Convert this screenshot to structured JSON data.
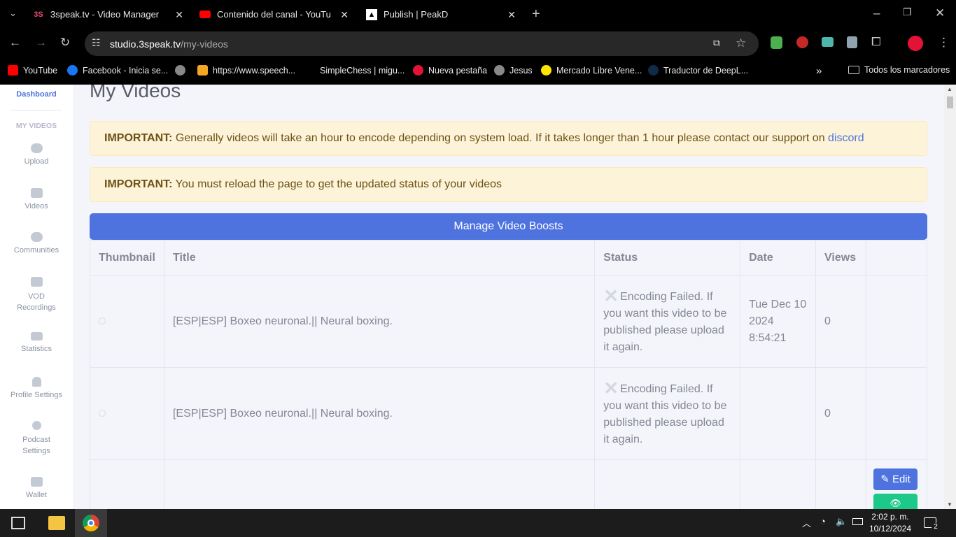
{
  "browser": {
    "tabs": [
      {
        "title": "3speak.tv - Video Manager",
        "favicon": "3speak-logo"
      },
      {
        "title": "Contenido del canal - YouTube",
        "favicon": "youtube-icon"
      },
      {
        "title": "Publish | PeakD",
        "favicon": "peakd-logo"
      }
    ],
    "url_host": "studio.3speak.tv",
    "url_path": "/my-videos",
    "bookmarks": [
      {
        "label": "YouTube",
        "color": "#ff0000"
      },
      {
        "label": "Facebook - Inicia se...",
        "color": "#1877f2"
      },
      {
        "label": "",
        "color": "#888888"
      },
      {
        "label": "https://www.speech...",
        "color": "#f5a623"
      },
      {
        "label": "SimpleChess | migu...",
        "color": "#000000"
      },
      {
        "label": "Nueva pestaña",
        "color": "#e31337"
      },
      {
        "label": "Jesus",
        "color": "#888888"
      },
      {
        "label": "Mercado Libre Vene...",
        "color": "#ffe600"
      },
      {
        "label": "Traductor de DeepL...",
        "color": "#0f2b46"
      }
    ],
    "all_bookmarks": "Todos los marcadores"
  },
  "sidebar": {
    "dashboard": "Dashboard",
    "section": "MY VIDEOS",
    "items": [
      {
        "label": "Upload",
        "icon": "cloud-upload-icon"
      },
      {
        "label": "Videos",
        "icon": "video-icon"
      },
      {
        "label": "Communities",
        "icon": "users-icon"
      },
      {
        "label": "VOD Recordings",
        "icon": "archive-icon"
      },
      {
        "label": "Statistics",
        "icon": "chart-icon"
      },
      {
        "label": "Profile Settings",
        "icon": "user-icon"
      },
      {
        "label": "Podcast Settings",
        "icon": "gear-icon"
      },
      {
        "label": "Wallet",
        "icon": "wallet-icon"
      }
    ]
  },
  "main": {
    "title": "My Videos",
    "alert1": {
      "strong": "IMPORTANT:",
      "text": " Generally videos will take an hour to encode depending on system load. If it takes longer than 1 hour please contact our support on ",
      "link": "discord"
    },
    "alert2": {
      "strong": "IMPORTANT:",
      "text": " You must reload the page to get the updated status of your videos"
    },
    "boost_button": "Manage Video Boosts",
    "table": {
      "headers": [
        "Thumbnail",
        "Title",
        "Status",
        "Date",
        "Views",
        ""
      ],
      "rows": [
        {
          "title": "[ESP|ESP] Boxeo neuronal.|| Neural boxing.",
          "status": "Encoding Failed. If you want this video to be published please upload it again.",
          "date": "Tue Dec 10 2024 8:54:21",
          "views": "0"
        },
        {
          "title": "[ESP|ESP] Boxeo neuronal.|| Neural boxing.",
          "status": "Encoding Failed. If you want this video to be published please upload it again.",
          "date": "",
          "views": "0"
        },
        {
          "title": "",
          "status": "",
          "date": "",
          "views": "",
          "edit": "Edit"
        }
      ]
    }
  },
  "taskbar": {
    "time": "2:02 p. m.",
    "date": "10/12/2024",
    "notifications": "2"
  }
}
